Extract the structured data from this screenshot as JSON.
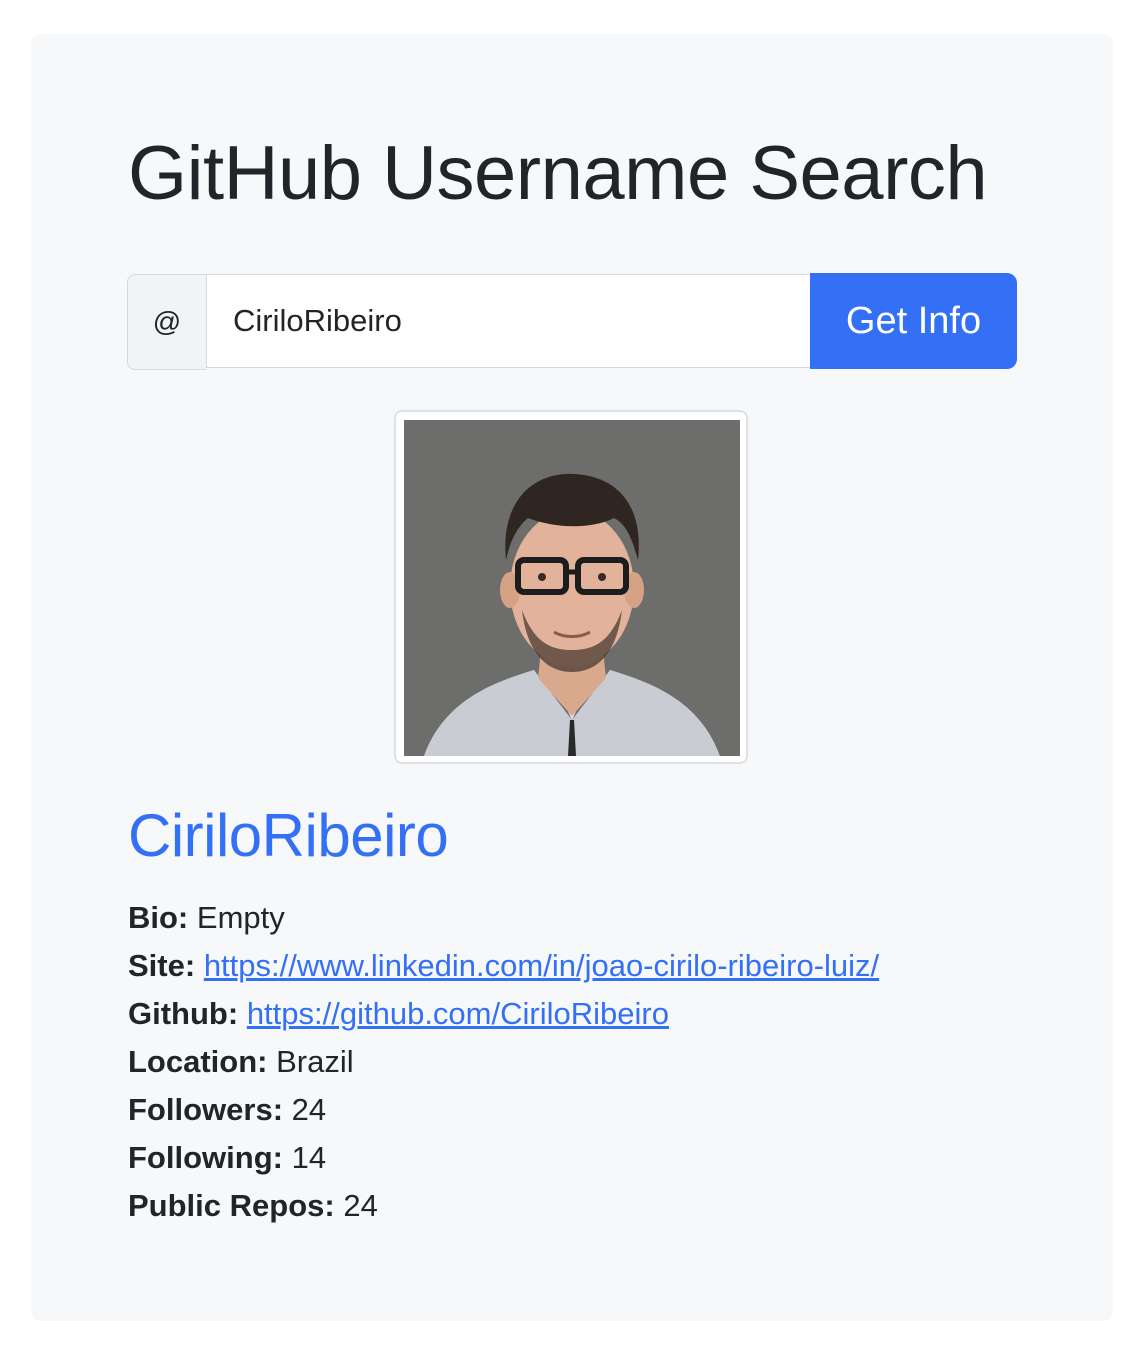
{
  "page": {
    "title": "GitHub Username Search"
  },
  "search": {
    "prefix": "@",
    "value": "CiriloRibeiro",
    "button_label": "Get Info"
  },
  "profile": {
    "name": "CiriloRibeiro",
    "bio_label": "Bio:",
    "bio": "Empty",
    "site_label": "Site:",
    "site": "https://www.linkedin.com/in/joao-cirilo-ribeiro-luiz/",
    "github_label": "Github:",
    "github": "https://github.com/CiriloRibeiro",
    "location_label": "Location:",
    "location": "Brazil",
    "followers_label": "Followers:",
    "followers": "24",
    "following_label": "Following:",
    "following": "14",
    "repos_label": "Public Repos:",
    "repos": "24"
  },
  "colors": {
    "accent": "#3370f5",
    "card_background": "#f7f8fa",
    "text": "#212529"
  }
}
